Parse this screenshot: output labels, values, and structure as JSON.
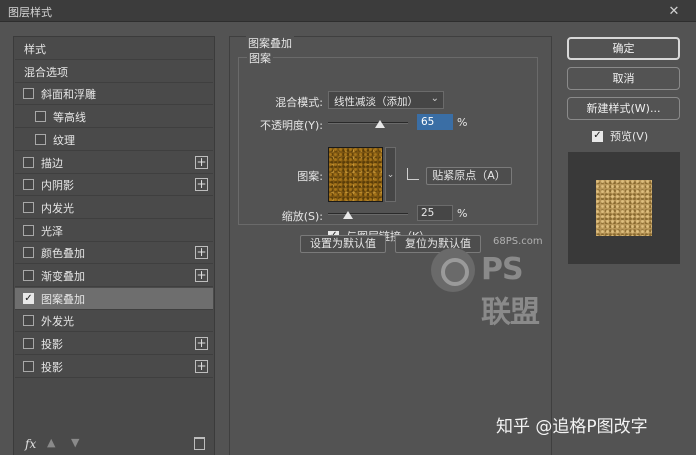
{
  "window": {
    "title": "图层样式",
    "close_icon": "close-icon"
  },
  "sidebar": {
    "items": [
      {
        "label": "样式",
        "checkbox": false,
        "checked": false,
        "plus": false,
        "selected": false,
        "indent": 0
      },
      {
        "label": "混合选项",
        "checkbox": false,
        "checked": false,
        "plus": false,
        "selected": false,
        "indent": 0
      },
      {
        "label": "斜面和浮雕",
        "checkbox": true,
        "checked": false,
        "plus": false,
        "selected": false,
        "indent": 0
      },
      {
        "label": "等高线",
        "checkbox": true,
        "checked": false,
        "plus": false,
        "selected": false,
        "indent": 1
      },
      {
        "label": "纹理",
        "checkbox": true,
        "checked": false,
        "plus": false,
        "selected": false,
        "indent": 1
      },
      {
        "label": "描边",
        "checkbox": true,
        "checked": false,
        "plus": true,
        "selected": false,
        "indent": 0
      },
      {
        "label": "内阴影",
        "checkbox": true,
        "checked": false,
        "plus": true,
        "selected": false,
        "indent": 0
      },
      {
        "label": "内发光",
        "checkbox": true,
        "checked": false,
        "plus": false,
        "selected": false,
        "indent": 0
      },
      {
        "label": "光泽",
        "checkbox": true,
        "checked": false,
        "plus": false,
        "selected": false,
        "indent": 0
      },
      {
        "label": "颜色叠加",
        "checkbox": true,
        "checked": false,
        "plus": true,
        "selected": false,
        "indent": 0
      },
      {
        "label": "渐变叠加",
        "checkbox": true,
        "checked": false,
        "plus": true,
        "selected": false,
        "indent": 0
      },
      {
        "label": "图案叠加",
        "checkbox": true,
        "checked": true,
        "plus": false,
        "selected": true,
        "indent": 0
      },
      {
        "label": "外发光",
        "checkbox": true,
        "checked": false,
        "plus": false,
        "selected": false,
        "indent": 0
      },
      {
        "label": "投影",
        "checkbox": true,
        "checked": false,
        "plus": true,
        "selected": false,
        "indent": 0
      },
      {
        "label": "投影",
        "checkbox": true,
        "checked": false,
        "plus": true,
        "selected": false,
        "indent": 0
      }
    ],
    "footer": {
      "fx_label": "fx",
      "up_icon": "move-up-icon",
      "down_icon": "move-down-icon",
      "trash_icon": "trash-icon"
    }
  },
  "pattern_overlay": {
    "group_title": "图案叠加",
    "subgroup_title": "图案",
    "blend_mode_label": "混合模式:",
    "blend_mode_value": "线性减淡（添加）",
    "opacity_label": "不透明度(Y):",
    "opacity_value": "65",
    "opacity_unit": "%",
    "opacity_level": 0.65,
    "pattern_label": "图案:",
    "snap_button": "贴紧原点（A）",
    "scale_label": "缩放(S):",
    "scale_value": "25",
    "scale_unit": "%",
    "scale_level": 0.25,
    "link_label": "与图层链接（K）",
    "link_checked": true,
    "set_default_button": "设置为默认值",
    "reset_default_button": "复位为默认值"
  },
  "actions": {
    "ok": "确定",
    "cancel": "取消",
    "new_style": "新建样式(W)...",
    "preview_label": "预览(V)",
    "preview_checked": true
  },
  "watermark": {
    "domain": "68PS.com",
    "brand": "PS联盟"
  },
  "credit": "知乎 @追格P图改字",
  "colors": {
    "accent": "#3a6ea5",
    "panel": "#535353",
    "selected_row": "#6e6e6e"
  }
}
